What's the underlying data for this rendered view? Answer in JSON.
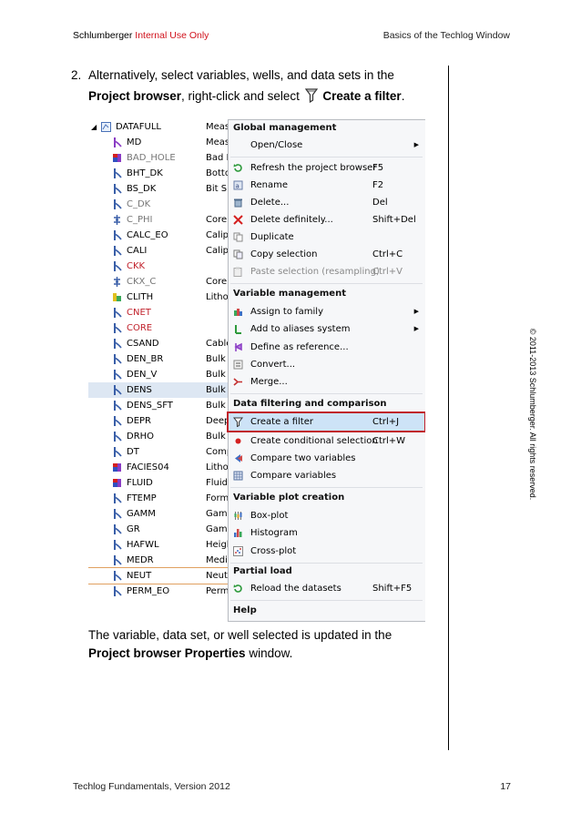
{
  "header": {
    "company": "Schlumberger",
    "internal": "Internal Use Only",
    "right": "Basics of the Techlog Window"
  },
  "copyright": "© 2011-2013 Schlumberger. All rights reserved.",
  "step": {
    "number": "2.",
    "text_before": "Alternatively, select variables, wells, and data sets in the",
    "bold1": "Project browser",
    "text_mid": ", right-click and select",
    "bold2": "Create a filter",
    "text_end": "."
  },
  "tree": {
    "root": "DATAFULL",
    "items": [
      {
        "name": "MD",
        "color": "#000",
        "icon": "purple-curve-icon"
      },
      {
        "name": "BAD_HOLE",
        "color": "#777",
        "icon": "flag-icon"
      },
      {
        "name": "BHT_DK",
        "color": "#000",
        "icon": "blue-curve-icon"
      },
      {
        "name": "BS_DK",
        "color": "#000",
        "icon": "blue-curve-icon"
      },
      {
        "name": "C_DK",
        "color": "#777",
        "icon": "blue-curve-icon"
      },
      {
        "name": "C_PHI",
        "color": "#777",
        "icon": "core-icon"
      },
      {
        "name": "CALC_EO",
        "color": "#000",
        "icon": "blue-curve-icon"
      },
      {
        "name": "CALI",
        "color": "#000",
        "icon": "blue-curve-icon"
      },
      {
        "name": "CKK",
        "color": "#c0202a",
        "icon": "blue-curve-icon"
      },
      {
        "name": "CKX_C",
        "color": "#777",
        "icon": "core-icon"
      },
      {
        "name": "CLITH",
        "color": "#000",
        "icon": "litho-icon"
      },
      {
        "name": "CNET",
        "color": "#c0202a",
        "icon": "blue-curve-icon"
      },
      {
        "name": "CORE",
        "color": "#c0202a",
        "icon": "blue-curve-icon"
      },
      {
        "name": "CSAND",
        "color": "#000",
        "icon": "blue-curve-icon"
      },
      {
        "name": "DEN_BR",
        "color": "#000",
        "icon": "blue-curve-icon"
      },
      {
        "name": "DEN_V",
        "color": "#000",
        "icon": "blue-curve-icon"
      },
      {
        "name": "DENS",
        "color": "#000",
        "icon": "blue-curve-icon"
      },
      {
        "name": "DENS_SFT",
        "color": "#000",
        "icon": "blue-curve-icon"
      },
      {
        "name": "DEPR",
        "color": "#000",
        "icon": "blue-curve-icon"
      },
      {
        "name": "DRHO",
        "color": "#000",
        "icon": "blue-curve-icon"
      },
      {
        "name": "DT",
        "color": "#000",
        "icon": "blue-curve-icon"
      },
      {
        "name": "FACIES04",
        "color": "#000",
        "icon": "flag-icon"
      },
      {
        "name": "FLUID",
        "color": "#000",
        "icon": "flag-icon"
      },
      {
        "name": "FTEMP",
        "color": "#000",
        "icon": "blue-curve-icon"
      },
      {
        "name": "GAMM",
        "color": "#000",
        "icon": "blue-curve-icon"
      },
      {
        "name": "GR",
        "color": "#000",
        "icon": "blue-curve-icon"
      },
      {
        "name": "HAFWL",
        "color": "#000",
        "icon": "blue-curve-icon"
      },
      {
        "name": "MEDR",
        "color": "#000",
        "icon": "blue-curve-icon"
      },
      {
        "name": "NEUT",
        "color": "#000",
        "icon": "blue-curve-icon"
      },
      {
        "name": "PERM_EO",
        "color": "#000",
        "icon": "blue-curve-icon"
      }
    ],
    "col2": [
      "Meas",
      "Meas",
      "Bad I",
      "Botto",
      "Bit Si",
      "",
      "Core",
      "Calip",
      "Calip",
      "",
      "Core",
      "Litho",
      "",
      "",
      "Cable",
      "Bulk I",
      "Bulk I",
      "Bulk I",
      "Bulk I",
      "Deep",
      "Bulk I",
      "Comp",
      "Litho",
      "Fluid",
      "Form",
      "Gamr",
      "Gamr",
      "Heigl",
      "Medi",
      "Neutr",
      "Perm"
    ]
  },
  "menu": {
    "sections": {
      "global": "Global management",
      "variable": "Variable management",
      "filtering": "Data filtering and comparison",
      "plot": "Variable plot creation",
      "partial": "Partial load",
      "help": "Help"
    },
    "items": {
      "open_close": "Open/Close",
      "refresh": "Refresh the project browser",
      "refresh_sc": "F5",
      "rename": "Rename",
      "rename_sc": "F2",
      "delete": "Delete...",
      "delete_sc": "Del",
      "delete_def": "Delete definitely...",
      "delete_def_sc": "Shift+Del",
      "duplicate": "Duplicate",
      "copy_sel": "Copy selection",
      "copy_sel_sc": "Ctrl+C",
      "paste_sel": "Paste selection (resampling)",
      "paste_sel_sc": "Ctrl+V",
      "assign": "Assign to family",
      "aliases": "Add to aliases system",
      "define_ref": "Define as reference...",
      "convert": "Convert...",
      "merge": "Merge...",
      "create_filter": "Create a filter",
      "create_filter_sc": "Ctrl+J",
      "cond_sel": "Create conditional selection",
      "cond_sel_sc": "Ctrl+W",
      "compare_two": "Compare two variables",
      "compare_vars": "Compare variables",
      "boxplot": "Box-plot",
      "histogram": "Histogram",
      "crossplot": "Cross-plot",
      "reload": "Reload the datasets",
      "reload_sc": "Shift+F5"
    }
  },
  "body2": {
    "text1": "The variable, data set, or well selected is updated in the",
    "bold": "Project browser Properties",
    "text2": "window."
  },
  "footer": {
    "left": "Techlog Fundamentals, Version 2012",
    "right": "17"
  }
}
